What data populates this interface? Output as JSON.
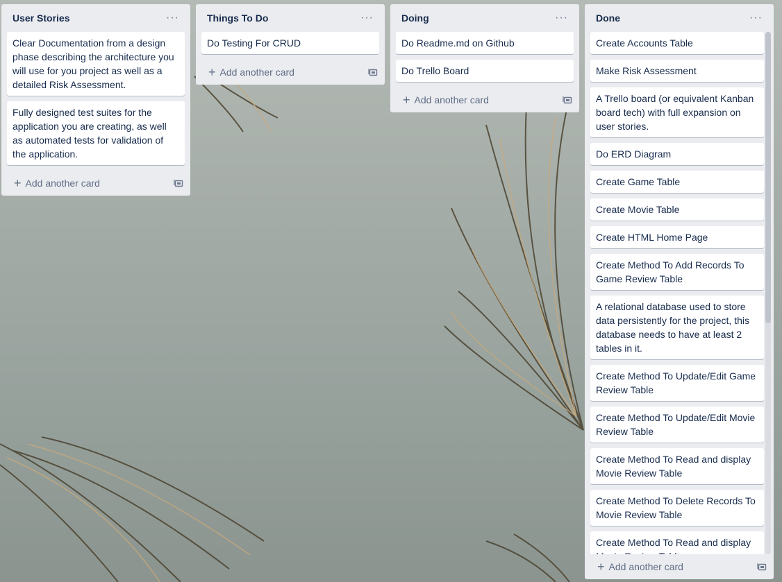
{
  "colors": {
    "list_bg": "#ebecf0",
    "card_bg": "#ffffff",
    "title": "#172b4d",
    "muted": "#5e6c84"
  },
  "board": {
    "lists": [
      {
        "title": "User Stories",
        "menu": "···",
        "cards": [
          "Clear Documentation from a design phase describing the architecture you will use for you project as well as a detailed Risk Assessment.",
          "Fully designed test suites for the application you are creating, as well as automated tests for validation of the application."
        ],
        "add_label": "Add another card"
      },
      {
        "title": "Things To Do",
        "menu": "···",
        "cards": [
          "Do Testing For CRUD"
        ],
        "add_label": "Add another card"
      },
      {
        "title": "Doing",
        "menu": "···",
        "cards": [
          "Do Readme.md on Github",
          "Do Trello Board"
        ],
        "add_label": "Add another card"
      },
      {
        "title": "Done",
        "menu": "···",
        "cards": [
          "Create Accounts Table",
          "Make Risk Assessment",
          "A Trello board (or equivalent Kanban board tech) with full expansion on user stories.",
          "Do ERD Diagram",
          "Create Game Table",
          "Create Movie Table",
          "Create HTML Home Page",
          "Create Method To Add Records To Game Review Table",
          "A relational database used to store data persistently for the project, this database needs to have at least 2 tables in it.",
          "Create Method To Update/Edit Game Review Table",
          "Create Method To Update/Edit Movie Review Table",
          "Create Method To Read and display Movie Review Table",
          "Create Method To Delete Records To Movie Review Table",
          "Create Method To Read and display Movie Review Table"
        ],
        "add_label": "Add another card"
      }
    ]
  },
  "icons": {
    "add": "plus-icon",
    "template": "card-template-icon",
    "menu": "more-menu-icon"
  }
}
